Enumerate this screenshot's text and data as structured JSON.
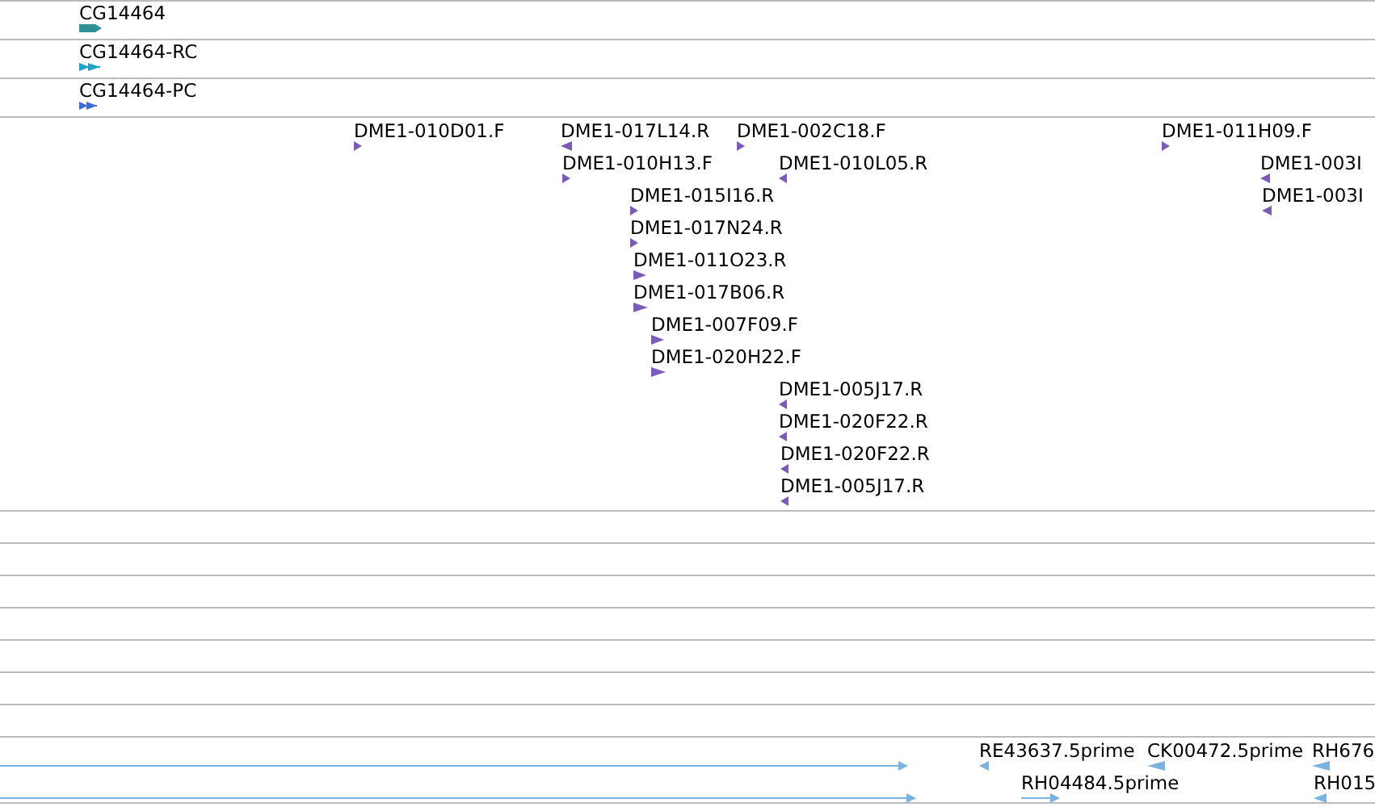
{
  "tracks": [
    {
      "kind": "gene",
      "color": "#2f8f94",
      "features": [
        {
          "label": "CG14464",
          "reverse": false
        }
      ]
    },
    {
      "kind": "transcript",
      "color": "#1fa3c9",
      "features": [
        {
          "label": "CG14464-RC",
          "reverse": false
        }
      ]
    },
    {
      "kind": "transcript",
      "color": "#3b6fd4",
      "features": [
        {
          "label": "CG14464-PC",
          "reverse": false
        }
      ]
    },
    {
      "kind": "est",
      "color": "#7a5cb8",
      "features": [
        {
          "label": "DME1-010D01.F",
          "reverse": false
        },
        {
          "label": "DME1-017L14.R",
          "reverse": true
        },
        {
          "label": "DME1-002C18.F",
          "reverse": false
        },
        {
          "label": "DME1-011H09.F",
          "reverse": false
        },
        {
          "label": "DME1-010H13.F",
          "reverse": false
        },
        {
          "label": "DME1-010L05.R",
          "reverse": true
        },
        {
          "label": "DME1-003I",
          "reverse": true
        },
        {
          "label": "DME1-015I16.R",
          "reverse": false
        },
        {
          "label": "DME1-003I",
          "reverse": true
        },
        {
          "label": "DME1-017N24.R",
          "reverse": false
        },
        {
          "label": "DME1-011O23.R",
          "reverse": false
        },
        {
          "label": "DME1-017B06.R",
          "reverse": false
        },
        {
          "label": "DME1-007F09.F",
          "reverse": false
        },
        {
          "label": "DME1-020H22.F",
          "reverse": false
        },
        {
          "label": "DME1-005J17.R",
          "reverse": true
        },
        {
          "label": "DME1-020F22.R",
          "reverse": true
        },
        {
          "label": "DME1-020F22.R",
          "reverse": true
        },
        {
          "label": "DME1-005J17.R",
          "reverse": true
        }
      ]
    },
    {
      "kind": "empty"
    },
    {
      "kind": "empty"
    },
    {
      "kind": "empty"
    },
    {
      "kind": "empty"
    },
    {
      "kind": "empty"
    },
    {
      "kind": "empty"
    },
    {
      "kind": "empty"
    },
    {
      "kind": "cdna",
      "color": "#7ab3de",
      "features": [
        {
          "reverse": false
        },
        {
          "label": "RE43637.5prime",
          "reverse": true
        },
        {
          "label": "CK00472.5prime",
          "reverse": true
        },
        {
          "label": "RH676",
          "reverse": true
        },
        {
          "reverse": false
        },
        {
          "label": "RH04484.5prime",
          "reverse": false
        },
        {
          "label": "RH015",
          "reverse": true
        }
      ]
    }
  ]
}
